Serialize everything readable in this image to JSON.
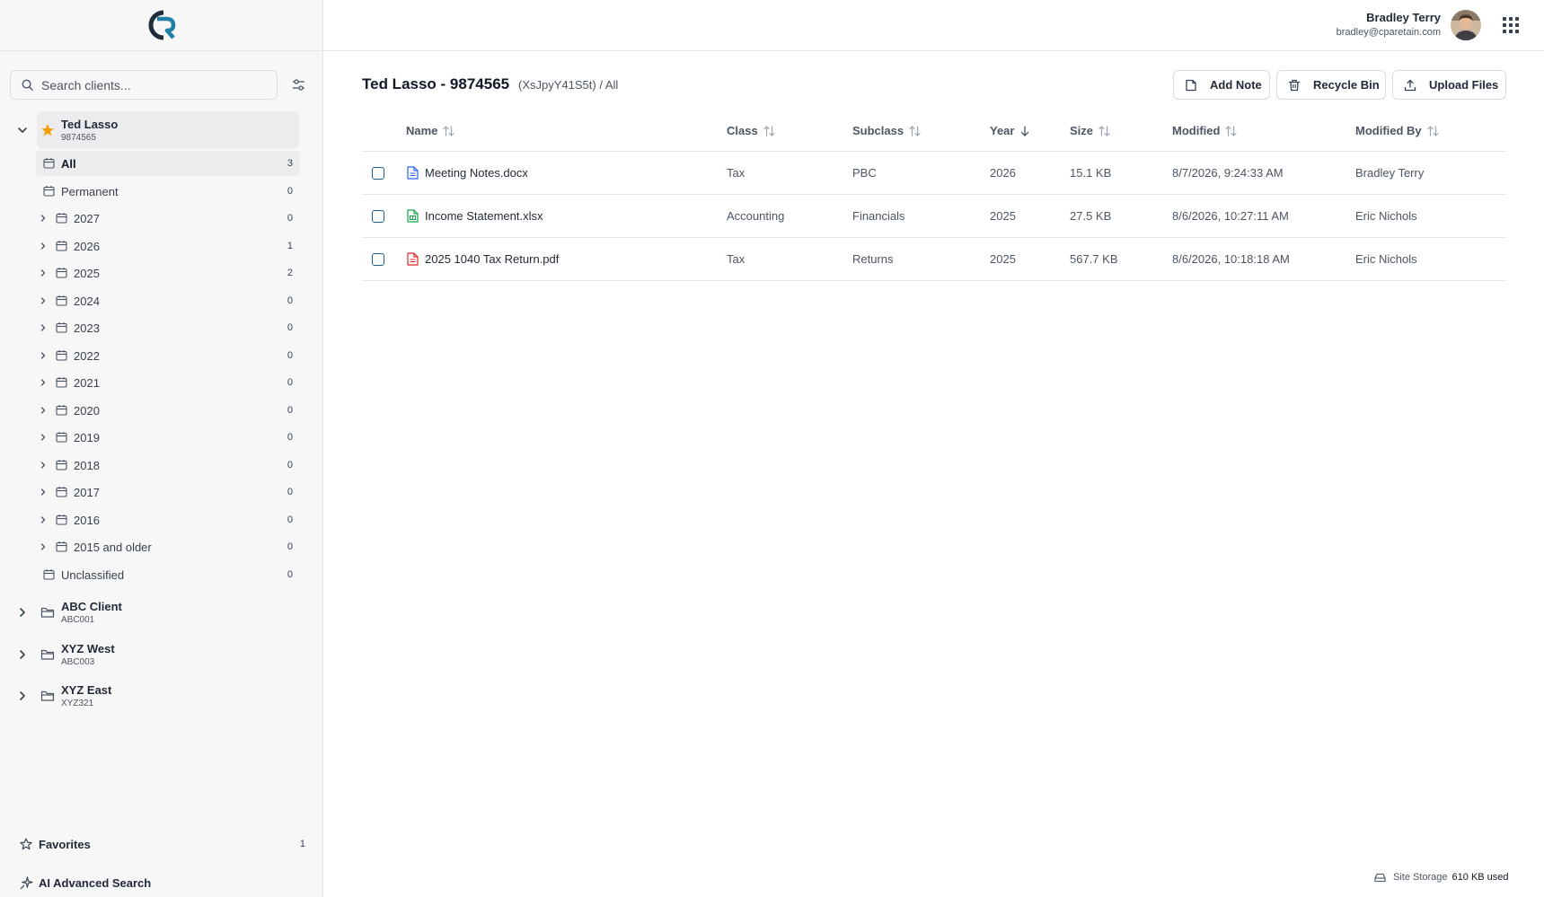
{
  "header": {
    "user_name": "Bradley Terry",
    "user_email": "bradley@cparetain.com"
  },
  "search": {
    "placeholder": "Search clients..."
  },
  "clients": [
    {
      "name": "Ted Lasso",
      "code": "9874565",
      "favorite": true,
      "expanded": true
    },
    {
      "name": "ABC Client",
      "code": "ABC001"
    },
    {
      "name": "XYZ West",
      "code": "ABC003"
    },
    {
      "name": "XYZ East",
      "code": "XYZ321"
    }
  ],
  "folders": [
    {
      "label": "All",
      "count": "3",
      "selected": true,
      "expandable": false
    },
    {
      "label": "Permanent",
      "count": "0",
      "expandable": false
    },
    {
      "label": "2027",
      "count": "0",
      "expandable": true
    },
    {
      "label": "2026",
      "count": "1",
      "expandable": true
    },
    {
      "label": "2025",
      "count": "2",
      "expandable": true
    },
    {
      "label": "2024",
      "count": "0",
      "expandable": true
    },
    {
      "label": "2023",
      "count": "0",
      "expandable": true
    },
    {
      "label": "2022",
      "count": "0",
      "expandable": true
    },
    {
      "label": "2021",
      "count": "0",
      "expandable": true
    },
    {
      "label": "2020",
      "count": "0",
      "expandable": true
    },
    {
      "label": "2019",
      "count": "0",
      "expandable": true
    },
    {
      "label": "2018",
      "count": "0",
      "expandable": true
    },
    {
      "label": "2017",
      "count": "0",
      "expandable": true
    },
    {
      "label": "2016",
      "count": "0",
      "expandable": true
    },
    {
      "label": "2015 and older",
      "count": "0",
      "expandable": true
    },
    {
      "label": "Unclassified",
      "count": "0",
      "expandable": false
    }
  ],
  "sidebar_footer": {
    "favorites_label": "Favorites",
    "favorites_count": "1",
    "ai_search_label": "AI Advanced Search"
  },
  "main": {
    "title": "Ted Lasso - 9874565",
    "subtitle": "(XsJpyY41S5t) / All",
    "add_note_label": "Add Note",
    "recycle_bin_label": "Recycle Bin",
    "upload_files_label": "Upload Files"
  },
  "table": {
    "columns": [
      "Name",
      "Class",
      "Subclass",
      "Year",
      "Size",
      "Modified",
      "Modified By"
    ],
    "sorted_column": "Year",
    "sort_direction": "desc",
    "rows": [
      {
        "name": "Meeting Notes.docx",
        "type": "docx",
        "class": "Tax",
        "subclass": "PBC",
        "year": "2026",
        "size": "15.1 KB",
        "modified": "8/7/2026, 9:24:33 AM",
        "modified_by": "Bradley Terry"
      },
      {
        "name": "Income Statement.xlsx",
        "type": "xlsx",
        "class": "Accounting",
        "subclass": "Financials",
        "year": "2025",
        "size": "27.5 KB",
        "modified": "8/6/2026, 10:27:11 AM",
        "modified_by": "Eric Nichols"
      },
      {
        "name": "2025 1040 Tax Return.pdf",
        "type": "pdf",
        "class": "Tax",
        "subclass": "Returns",
        "year": "2025",
        "size": "567.7 KB",
        "modified": "8/6/2026, 10:18:18 AM",
        "modified_by": "Eric Nichols"
      }
    ]
  },
  "storage": {
    "label": "Site Storage",
    "used": "610 KB used"
  },
  "colors": {
    "accent": "#1f5f8b",
    "star": "#f59e0b",
    "docx_icon": "#2563eb",
    "xlsx_icon": "#16a34a",
    "pdf_icon": "#dc2626"
  }
}
